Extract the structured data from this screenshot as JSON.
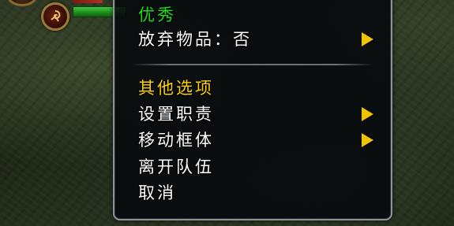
{
  "menu": {
    "header_priority": "优秀",
    "discard_items": "放弃物品：否",
    "other_options_header": "其他选项",
    "set_role": "设置职责",
    "move_frame": "移动框体",
    "leave_party": "离开队伍",
    "cancel": "取消"
  },
  "unit_frame": {
    "role_icon": "role-icon",
    "health_fill": 1.0
  },
  "colors": {
    "green_header": "#1fdc1f",
    "gold_header": "#ffd000",
    "arrow": "#f0c400",
    "menu_border": "#8e9196"
  }
}
